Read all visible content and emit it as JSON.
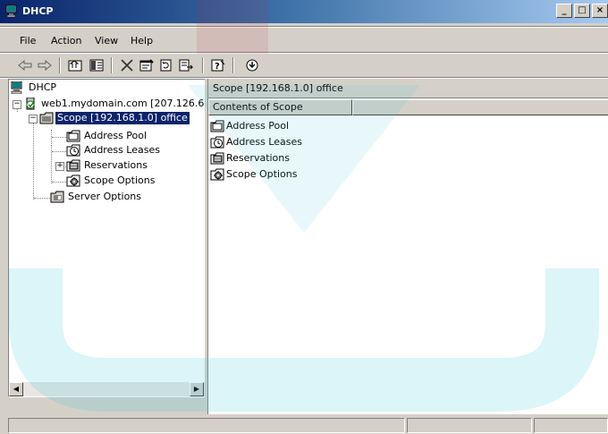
{
  "window": {
    "title": "DHCP",
    "controls": [
      "_",
      "□",
      "×"
    ]
  },
  "menu": [
    "File",
    "Action",
    "View",
    "Help"
  ],
  "toolbar": {
    "buttons": [
      "back-icon",
      "forward-icon",
      "up-icon",
      "show-hide-tree-icon",
      "delete-icon",
      "properties-icon",
      "refresh-icon",
      "export-list-icon",
      "help-icon",
      "action-icon"
    ]
  },
  "tree": {
    "root": "DHCP",
    "server": "web1.mydomain.com [207.126.6",
    "scope": "Scope [192.168.1.0] office",
    "scope_children": [
      "Address Pool",
      "Address Leases",
      "Reservations",
      "Scope Options"
    ],
    "server_options": "Server Options"
  },
  "content": {
    "header": "Scope [192.168.1.0] office",
    "column": "Contents of Scope",
    "items": [
      "Address Pool",
      "Address Leases",
      "Reservations",
      "Scope Options"
    ]
  },
  "colors": {
    "titlebar_start": "#0a246a",
    "titlebar_end": "#a6caf0",
    "selection": "#0a246a",
    "chrome": "#d4d0c8"
  }
}
